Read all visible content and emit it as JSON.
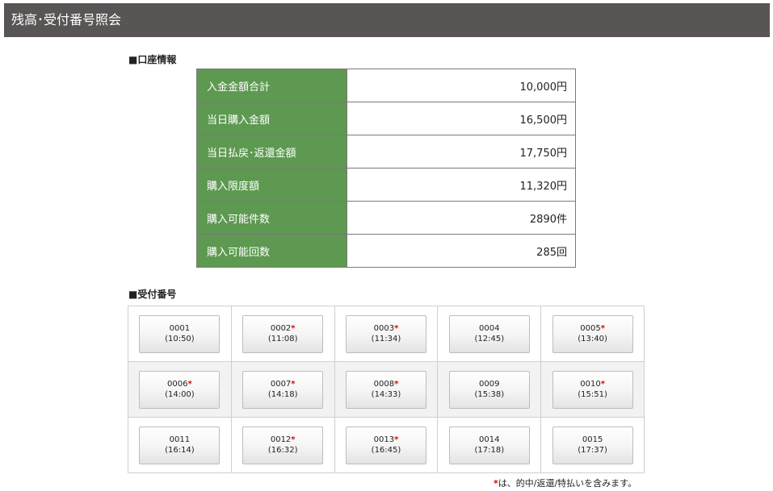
{
  "header": {
    "title": "残高･受付番号照会"
  },
  "account_section": {
    "title": "■口座情報",
    "rows": [
      {
        "label": "入金金額合計",
        "value": "10,000円"
      },
      {
        "label": "当日購入金額",
        "value": "16,500円"
      },
      {
        "label": "当日払戻･返還金額",
        "value": "17,750円"
      },
      {
        "label": "購入限度額",
        "value": "11,320円"
      },
      {
        "label": "購入可能件数",
        "value": "2890件"
      },
      {
        "label": "購入可能回数",
        "value": "285回"
      }
    ]
  },
  "receipt_section": {
    "title": "■受付番号",
    "items": [
      {
        "number": "0001",
        "time": "(10:50)",
        "mark": ""
      },
      {
        "number": "0002",
        "time": "(11:08)",
        "mark": "*"
      },
      {
        "number": "0003",
        "time": "(11:34)",
        "mark": "*"
      },
      {
        "number": "0004",
        "time": "(12:45)",
        "mark": ""
      },
      {
        "number": "0005",
        "time": "(13:40)",
        "mark": "*"
      },
      {
        "number": "0006",
        "time": "(14:00)",
        "mark": "*"
      },
      {
        "number": "0007",
        "time": "(14:18)",
        "mark": "*"
      },
      {
        "number": "0008",
        "time": "(14:33)",
        "mark": "*"
      },
      {
        "number": "0009",
        "time": "(15:38)",
        "mark": ""
      },
      {
        "number": "0010",
        "time": "(15:51)",
        "mark": "*"
      },
      {
        "number": "0011",
        "time": "(16:14)",
        "mark": ""
      },
      {
        "number": "0012",
        "time": "(16:32)",
        "mark": "*"
      },
      {
        "number": "0013",
        "time": "(16:45)",
        "mark": "*"
      },
      {
        "number": "0014",
        "time": "(17:18)",
        "mark": ""
      },
      {
        "number": "0015",
        "time": "(17:37)",
        "mark": ""
      }
    ],
    "note_mark": "*",
    "note_text": "は、的中/返還/特払いを含みます。"
  },
  "colors": {
    "header_bg": "#595555",
    "label_bg": "#5d9950",
    "mark": "#e00000"
  }
}
